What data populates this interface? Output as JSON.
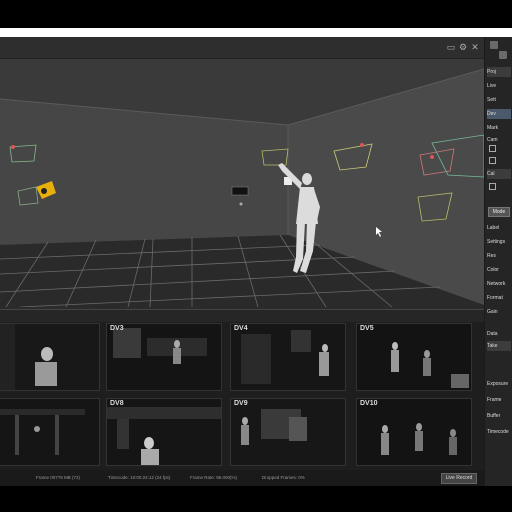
{
  "viewport": {
    "tooltip_label": "▭▭▭"
  },
  "right_panel": {
    "items": [
      "Proj",
      "Live",
      "Sett",
      "Dev",
      "Mark",
      "Cam",
      "Cal",
      "Data",
      "Take"
    ],
    "buttons": [
      "Mode"
    ],
    "properties": [
      "Label",
      "Settings",
      "Res",
      "Color",
      "Network",
      "Format",
      "Gain"
    ],
    "lower_properties": [
      "Exposure",
      "Frame",
      "Buffer",
      "Timecode"
    ]
  },
  "cameras": [
    {
      "label": ""
    },
    {
      "label": "DV3"
    },
    {
      "label": "DV4"
    },
    {
      "label": "DV5"
    },
    {
      "label": ""
    },
    {
      "label": "DV8"
    },
    {
      "label": "DV9"
    },
    {
      "label": "DV10"
    }
  ],
  "status": {
    "frame": "Frame 00778 MB (72)",
    "timecode": "Timecode: 10:00:24:12 (24 fps)",
    "frame_rate": "Frame Rate: 96.000(%)",
    "dropped": "Dropped Frames: 0%",
    "button": "Live Record"
  }
}
